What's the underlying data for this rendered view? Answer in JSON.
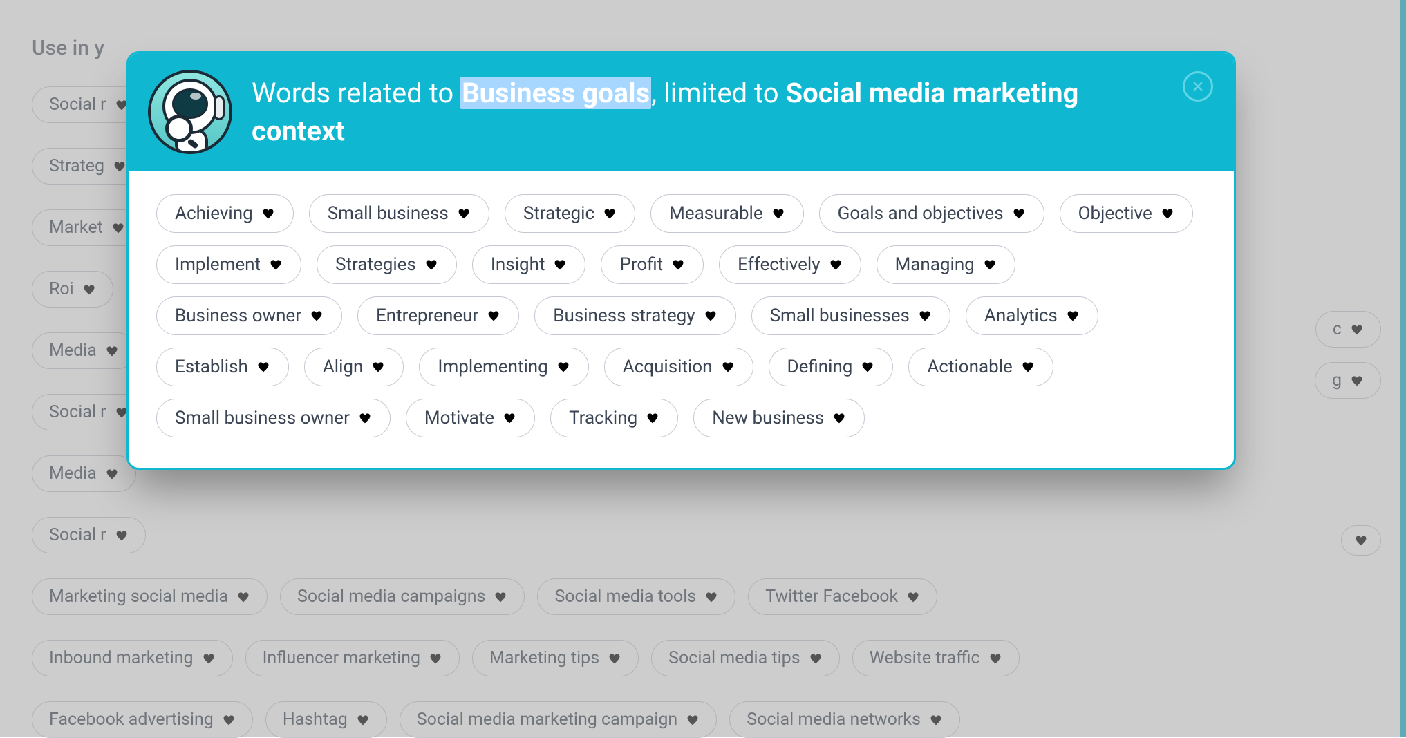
{
  "background": {
    "heading": "Use in y",
    "chips": [
      "Social r",
      "Strateg",
      "Market",
      "Roi",
      "Media",
      "Social r",
      "Media",
      "Social r",
      "Marketing social media",
      "Social media campaigns",
      "Social media tools",
      "Twitter Facebook",
      "Inbound marketing",
      "Influencer marketing",
      "Marketing tips",
      "Social media tips",
      "Website traffic",
      "Facebook advertising",
      "Hashtag",
      "Social media marketing campaign",
      "Social media networks"
    ],
    "extra_chips_right": [
      "c",
      "g"
    ],
    "extra_heart_only": true
  },
  "modal": {
    "title": {
      "prefix": "Words related to ",
      "highlighted": "Business goals",
      "middle": ", limited to ",
      "context": "Social media marketing context"
    },
    "chips": [
      "Achieving",
      "Small business",
      "Strategic",
      "Measurable",
      "Goals and objectives",
      "Objective",
      "Implement",
      "Strategies",
      "Insight",
      "Profit",
      "Effectively",
      "Managing",
      "Business owner",
      "Entrepreneur",
      "Business strategy",
      "Small businesses",
      "Analytics",
      "Establish",
      "Align",
      "Implementing",
      "Acquisition",
      "Defining",
      "Actionable",
      "Small business owner",
      "Motivate",
      "Tracking",
      "New business"
    ]
  }
}
